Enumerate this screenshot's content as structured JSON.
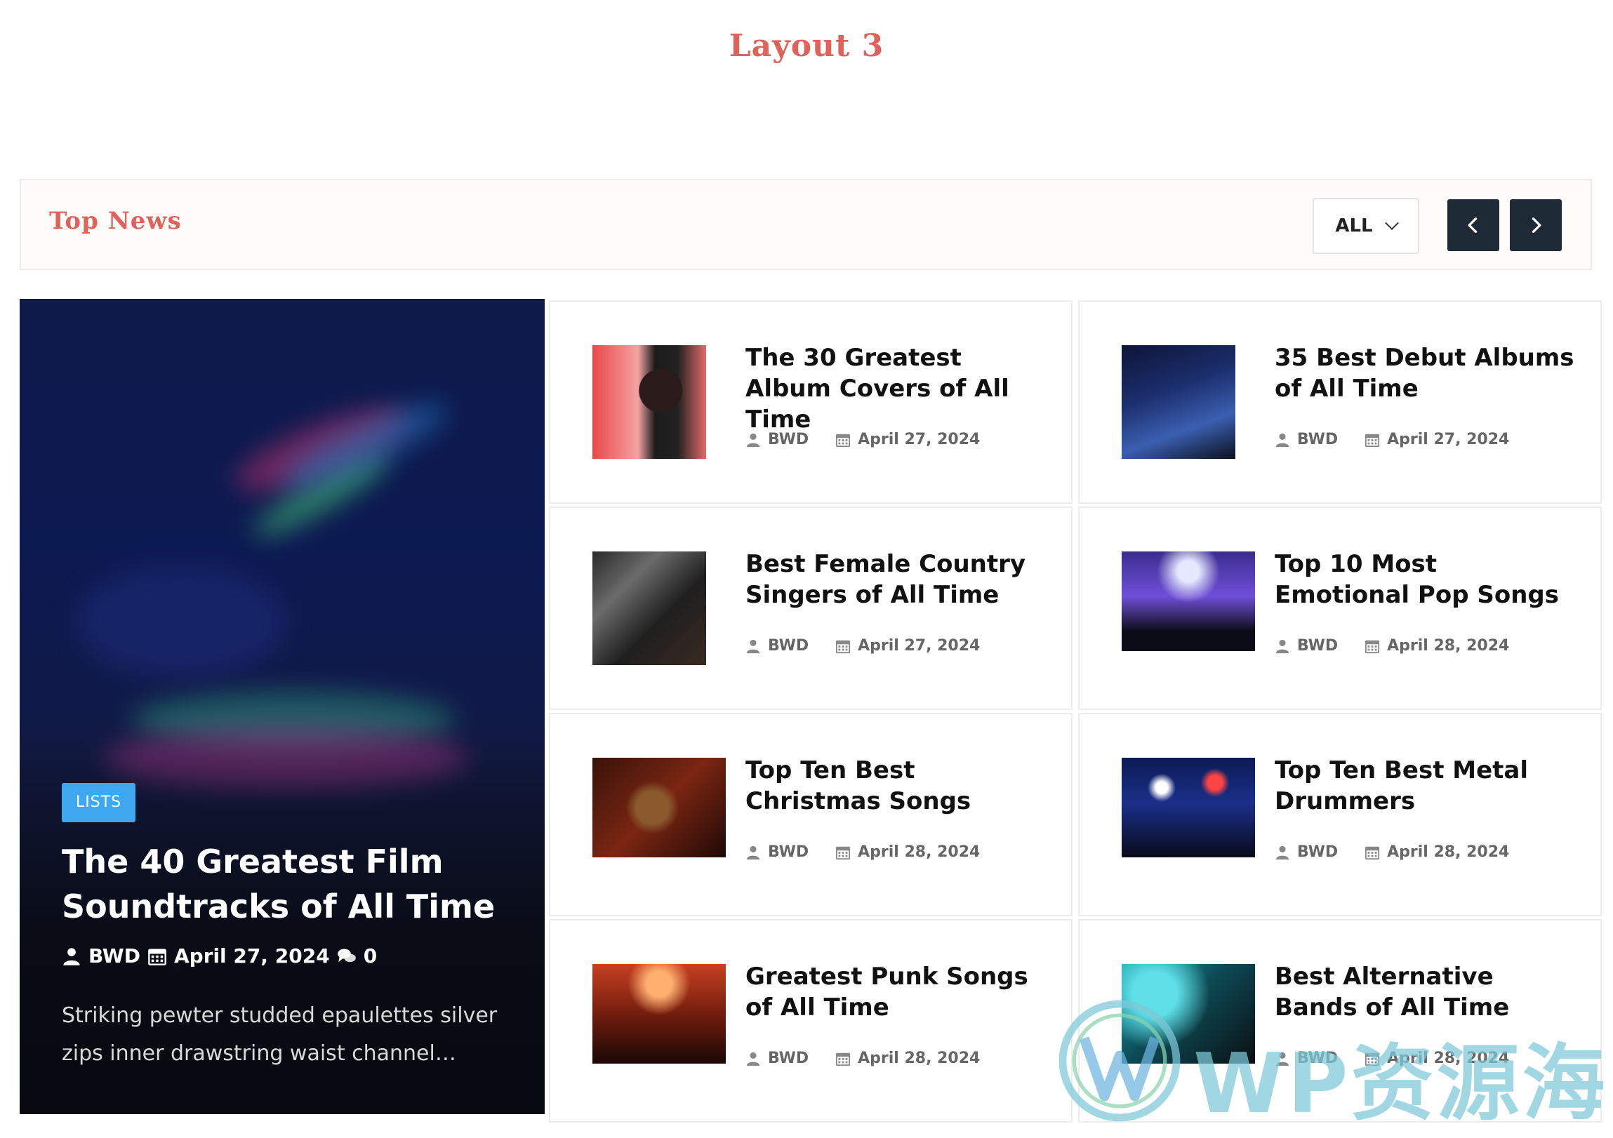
{
  "layout_title": "Layout 3",
  "header": {
    "title": "Top News",
    "filter_label": "ALL"
  },
  "feature": {
    "category": "LISTS",
    "title": "The 40 Greatest Film Soundtracks of All Time",
    "author": "BWD",
    "date": "April 27, 2024",
    "comments": "0",
    "excerpt": "Striking pewter studded epaulettes silver zips inner drawstring waist channel…"
  },
  "cards": [
    {
      "title": "The 30 Greatest Album Covers of All Time",
      "author": "BWD",
      "date": "April 27, 2024"
    },
    {
      "title": "35 Best Debut Albums of All Time",
      "author": "BWD",
      "date": "April 27, 2024"
    },
    {
      "title": "Best Female Country Singers of All Time",
      "author": "BWD",
      "date": "April 27, 2024"
    },
    {
      "title": "Top 10 Most Emotional Pop Songs",
      "author": "BWD",
      "date": "April 28, 2024"
    },
    {
      "title": "Top Ten Best Christmas Songs",
      "author": "BWD",
      "date": "April 28, 2024"
    },
    {
      "title": "Top Ten Best Metal Drummers",
      "author": "BWD",
      "date": "April 28, 2024"
    },
    {
      "title": "Greatest Punk Songs of All Time",
      "author": "BWD",
      "date": "April 28, 2024"
    },
    {
      "title": "Best Alternative Bands of All Time",
      "author": "BWD",
      "date": "April 28, 2024"
    }
  ],
  "watermark": "WP资源海",
  "colors": {
    "accent": "#e0625a",
    "badge": "#3ea7f0",
    "nav_button": "#1e2a36"
  }
}
